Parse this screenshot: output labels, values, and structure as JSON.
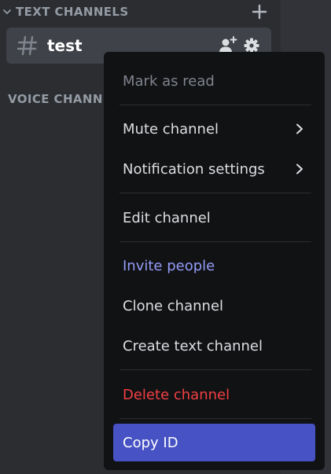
{
  "sidebar": {
    "text_category": {
      "label": "TEXT CHANNELS",
      "add_icon": "plus-icon"
    },
    "channel": {
      "name": "test",
      "icon": "hash-icon",
      "actions": [
        "invite-icon",
        "gear-icon"
      ]
    },
    "voice_category": {
      "label": "VOICE CHANNELS"
    }
  },
  "context_menu": {
    "mark_as_read": "Mark as read",
    "mute_channel": "Mute channel",
    "notification_settings": "Notification settings",
    "edit_channel": "Edit channel",
    "invite_people": "Invite people",
    "clone_channel": "Clone channel",
    "create_text_channel": "Create text channel",
    "delete_channel": "Delete channel",
    "copy_id": "Copy ID"
  },
  "colors": {
    "background": "#313338",
    "sidebar": "#2b2d31",
    "menu": "#111214",
    "accent_text": "#949cf7",
    "danger_text": "#f23f43",
    "highlight": "#4752c4"
  }
}
